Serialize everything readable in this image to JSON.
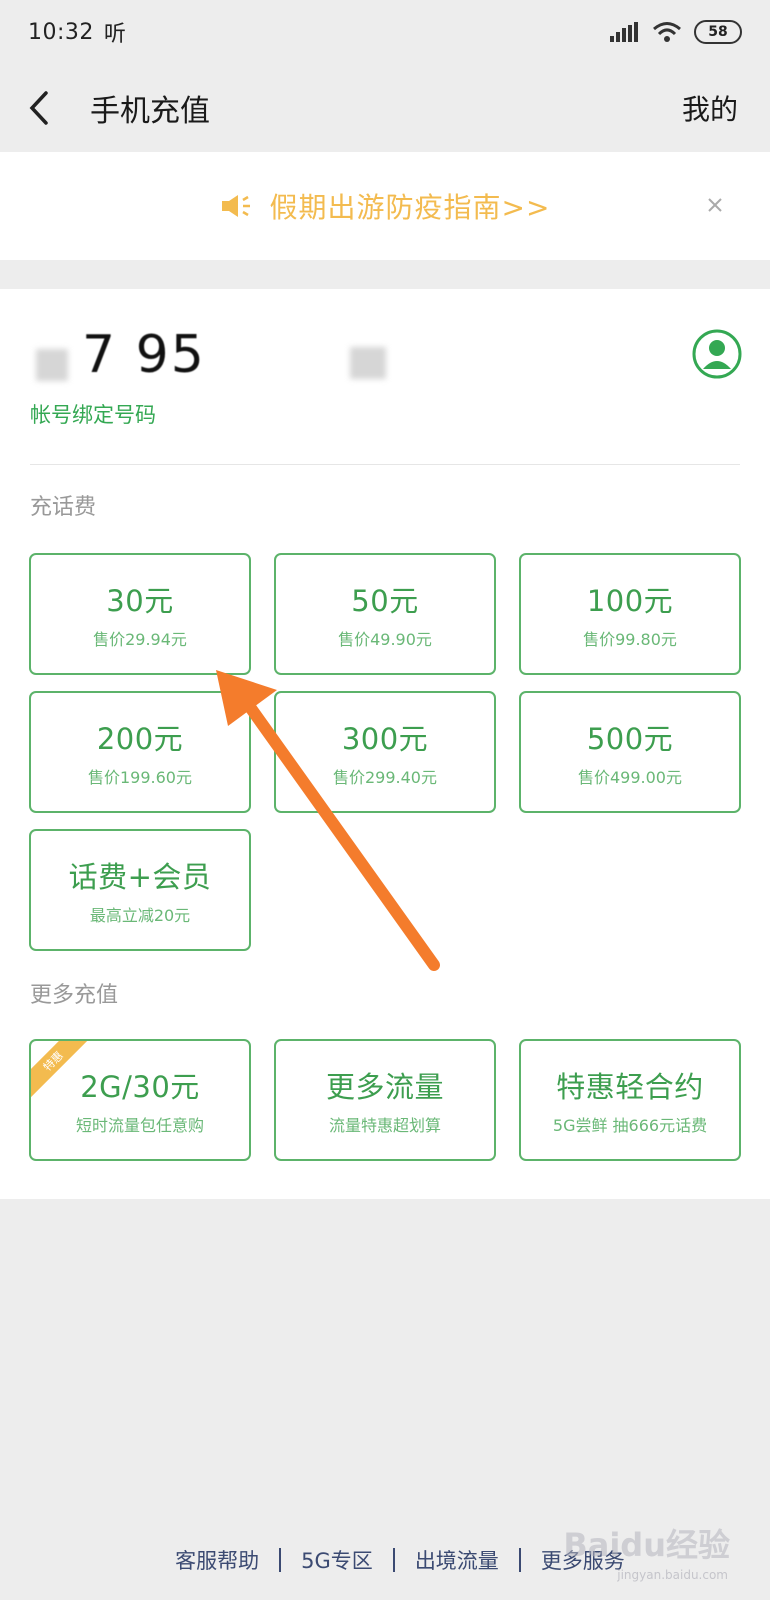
{
  "status": {
    "time": "10:32",
    "extra": "听",
    "battery": "58"
  },
  "nav": {
    "title": "手机充值",
    "my_label": "我的"
  },
  "notice": {
    "text": "假期出游防疫指南>>"
  },
  "account": {
    "phone_visible": "7  95",
    "bind_label": "帐号绑定号码"
  },
  "recharge": {
    "label": "充话费",
    "tiles": [
      {
        "main": "30元",
        "sub": "售价29.94元"
      },
      {
        "main": "50元",
        "sub": "售价49.90元"
      },
      {
        "main": "100元",
        "sub": "售价99.80元"
      },
      {
        "main": "200元",
        "sub": "售价199.60元"
      },
      {
        "main": "300元",
        "sub": "售价299.40元"
      },
      {
        "main": "500元",
        "sub": "售价499.00元"
      },
      {
        "main": "话费+会员",
        "sub": "最高立减20元"
      }
    ]
  },
  "more": {
    "label": "更多充值",
    "tiles": [
      {
        "main": "2G/30元",
        "sub": "短时流量包任意购",
        "badge": "特惠"
      },
      {
        "main": "更多流量",
        "sub": "流量特惠超划算"
      },
      {
        "main": "特惠轻合约",
        "sub": "5G尝鲜 抽666元话费"
      }
    ]
  },
  "footer": {
    "links": [
      "客服帮助",
      "5G专区",
      "出境流量",
      "更多服务"
    ]
  },
  "watermark": {
    "text": "Baidu经验",
    "sub": "jingyan.baidu.com"
  },
  "colors": {
    "accent_green": "#3d9e4f",
    "notice_yellow": "#f3bb4f",
    "arrow_orange": "#f47c2c"
  }
}
